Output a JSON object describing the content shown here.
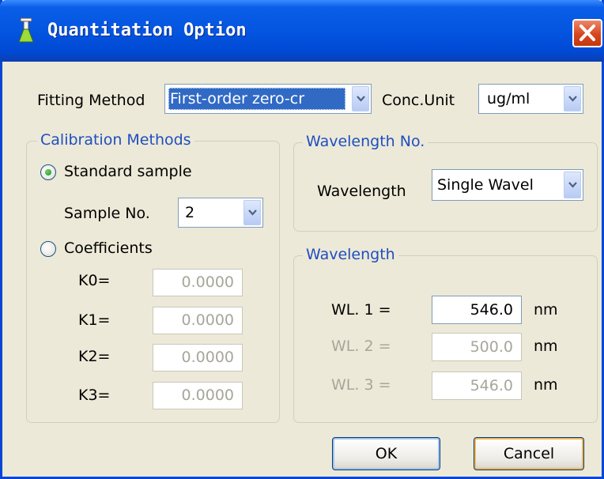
{
  "window": {
    "title": "Quantitation Option",
    "close_icon": "close-icon",
    "app_icon": "flask-icon"
  },
  "fitting": {
    "label": "Fitting Method",
    "value": "First-order zero-cr",
    "conc_label": "Conc.Unit",
    "conc_value": "ug/ml"
  },
  "calibration": {
    "title": "Calibration Methods",
    "standard_label": "Standard sample",
    "sample_no_label": "Sample No.",
    "sample_no_value": "2",
    "coefficients_label": "Coefficients",
    "coefficients": [
      {
        "label": "K0=",
        "value": "0.0000"
      },
      {
        "label": "K1=",
        "value": "0.0000"
      },
      {
        "label": "K2=",
        "value": "0.0000"
      },
      {
        "label": "K3=",
        "value": "0.0000"
      }
    ]
  },
  "wavelength_no": {
    "title": "Wavelength No.",
    "label": "Wavelength",
    "value": "Single Wavel"
  },
  "wavelength": {
    "title": "Wavelength",
    "rows": [
      {
        "label": "WL. 1 =",
        "value": "546.0",
        "unit": "nm"
      },
      {
        "label": "WL. 2 =",
        "value": "500.0",
        "unit": "nm"
      },
      {
        "label": "WL. 3 =",
        "value": "546.0",
        "unit": "nm"
      }
    ]
  },
  "buttons": {
    "ok": "OK",
    "cancel": "Cancel"
  },
  "colors": {
    "titlebar": "#0455e0",
    "group_title": "#1f4ec0",
    "selection": "#316ac5",
    "close": "#d8461e"
  }
}
